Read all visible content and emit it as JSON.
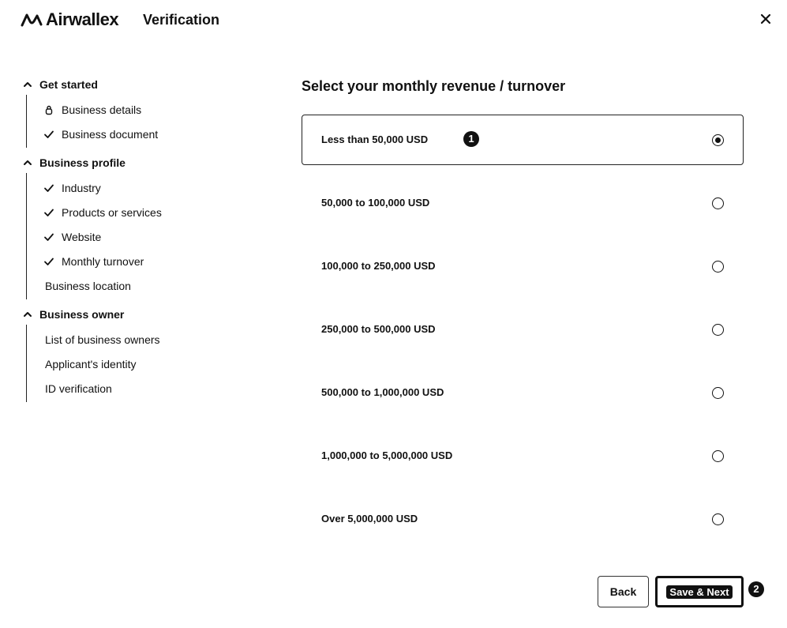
{
  "header": {
    "logo_text": "Airwallex",
    "title": "Verification",
    "close_icon": "close-icon"
  },
  "sidebar": {
    "sections": [
      {
        "title": "Get started",
        "items": [
          {
            "label": "Business details",
            "icon": "lock-icon"
          },
          {
            "label": "Business document",
            "icon": "check-icon"
          }
        ]
      },
      {
        "title": "Business profile",
        "items": [
          {
            "label": "Industry",
            "icon": "check-icon"
          },
          {
            "label": "Products or services",
            "icon": "check-icon"
          },
          {
            "label": "Website",
            "icon": "check-icon"
          },
          {
            "label": "Monthly turnover",
            "icon": "check-icon"
          },
          {
            "label": "Business location",
            "icon": ""
          }
        ]
      },
      {
        "title": "Business owner",
        "items": [
          {
            "label": "List of business owners",
            "icon": ""
          },
          {
            "label": "Applicant's identity",
            "icon": ""
          },
          {
            "label": "ID verification",
            "icon": ""
          }
        ]
      }
    ]
  },
  "main": {
    "title": "Select your monthly revenue / turnover",
    "options": [
      {
        "label": "Less than 50,000 USD",
        "selected": true
      },
      {
        "label": "50,000 to 100,000 USD",
        "selected": false
      },
      {
        "label": "100,000 to 250,000 USD",
        "selected": false
      },
      {
        "label": "250,000 to 500,000 USD",
        "selected": false
      },
      {
        "label": "500,000 to 1,000,000 USD",
        "selected": false
      },
      {
        "label": "1,000,000 to 5,000,000 USD",
        "selected": false
      },
      {
        "label": "Over 5,000,000 USD",
        "selected": false
      }
    ]
  },
  "annotations": {
    "marker_1": "1",
    "marker_2": "2"
  },
  "footer": {
    "back_label": "Back",
    "next_label": "Save & Next"
  }
}
